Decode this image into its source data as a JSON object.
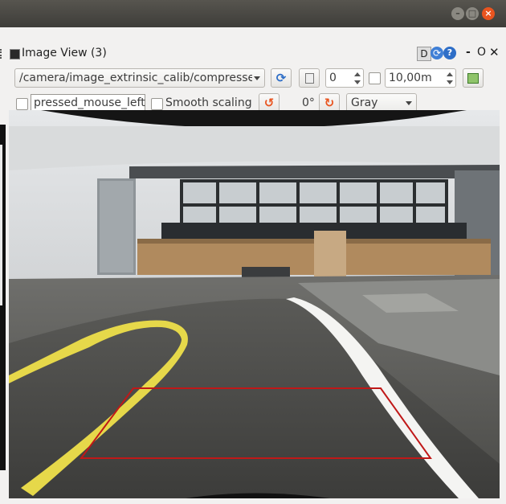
{
  "window": {
    "minimize_glyph": "–",
    "maximize_glyph": "□",
    "close_glyph": "×"
  },
  "dock": {
    "title": "Image View (3)",
    "d_label": "D",
    "reload_glyph": "⟳",
    "help_glyph": "?",
    "dash_glyph": "-",
    "o_glyph": "O",
    "close_glyph": "✕"
  },
  "toolbar": {
    "topic": "/camera/image_extrinsic_calib/compresse",
    "refresh_glyph": "⟳",
    "zoom_value": "0",
    "max_range": "10,00m",
    "mouse_topic": "pressed_mouse_left",
    "smooth_scaling_label": "Smooth scaling",
    "rotate_left_glyph": "↺",
    "rotation_value": "0°",
    "rotate_right_glyph": "↻",
    "color_scheme": "Gray"
  },
  "colors": {
    "overlay_rect": "#c01818",
    "accent_orange": "#e9541f",
    "accent_blue": "#3f7fd6"
  }
}
